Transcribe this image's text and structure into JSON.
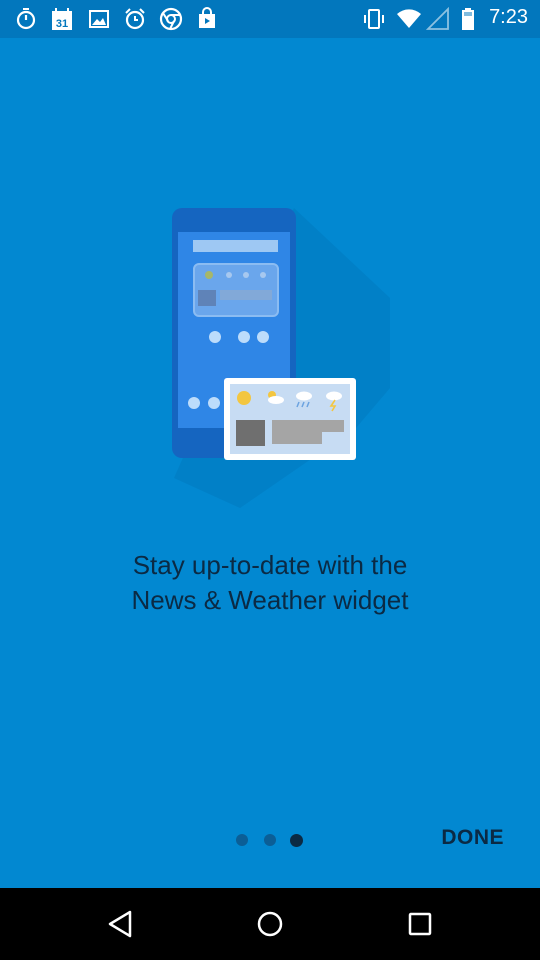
{
  "status_bar": {
    "left_icons": [
      "stopwatch-icon",
      "calendar-icon",
      "image-icon",
      "alarm-icon",
      "chrome-icon",
      "play-store-icon"
    ],
    "calendar_day": "31",
    "right_icons": [
      "vibrate-icon",
      "wifi-icon",
      "cell-signal-icon",
      "battery-icon"
    ],
    "time": "7:23"
  },
  "onboarding": {
    "headline_line1": "Stay up-to-date with the",
    "headline_line2": "News & Weather widget",
    "page_count": 3,
    "active_page": 3,
    "done_label": "DONE"
  },
  "nav_bar": {
    "buttons": [
      "back-icon",
      "home-icon",
      "recents-icon"
    ]
  },
  "colors": {
    "background": "#0288d1",
    "status_bar": "#0277bd",
    "text_dark": "#0b2a44",
    "dot_inactive": "#0b5e96"
  }
}
